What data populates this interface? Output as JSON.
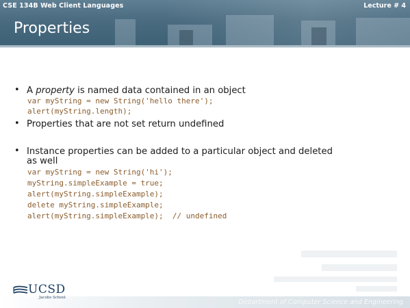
{
  "header": {
    "course": "CSE 134B  Web Client Languages",
    "lecture": "Lecture # 4",
    "title": "Properties"
  },
  "bullets": [
    {
      "prefix": "A ",
      "emphasis": "property",
      "suffix": " is named data contained in an object",
      "code": [
        "var myString = new String('hello there');",
        "alert(myString.length);"
      ]
    },
    {
      "text": "Properties that are not set return undefined"
    },
    {
      "text_line1": "Instance properties can be added to a particular object and deleted",
      "text_line2": "as well",
      "code": [
        "var myString = new String('hi');",
        "myString.simpleExample = true;",
        "alert(myString.simpleExample);",
        "delete myString.simpleExample;",
        "alert(myString.simpleExample);  // undefined"
      ]
    }
  ],
  "footer": {
    "logo_text": "UCSD",
    "logo_sub": "Jacobs School",
    "department": "Department of Computer Science and Engineering"
  },
  "colors": {
    "header_bg": "#4a6b80",
    "code_text": "#8a5c2c",
    "logo_blue": "#1c3f63"
  }
}
